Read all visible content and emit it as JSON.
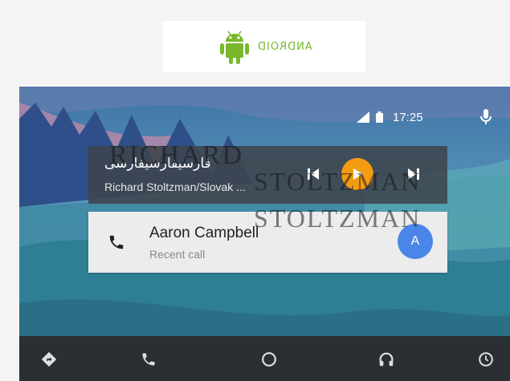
{
  "logo": {
    "wordmark": "ANDROID",
    "brand_color": "#78b82a"
  },
  "status": {
    "time": "17:25",
    "icons": [
      "signal-icon",
      "battery-icon",
      "mic-icon"
    ]
  },
  "watermark": {
    "line1": "RICHARD",
    "line2": "STOLTZMAN",
    "line3": "STOLTZMAN"
  },
  "now_playing": {
    "title": "فارسیفارسیفارسی",
    "artist": "Richard Stoltzman/Slovak ...",
    "accent_color": "#f39c12",
    "controls": [
      "skip-previous-icon",
      "play-icon",
      "skip-next-icon"
    ]
  },
  "recent_call": {
    "name": "Aaron Campbell",
    "subtitle": "Recent call",
    "avatar_initial": "A",
    "avatar_color": "#4a86e8"
  },
  "navbar": {
    "items": [
      "navigation-icon",
      "phone-icon",
      "home-icon",
      "headphones-icon",
      "notifications-icon"
    ]
  }
}
